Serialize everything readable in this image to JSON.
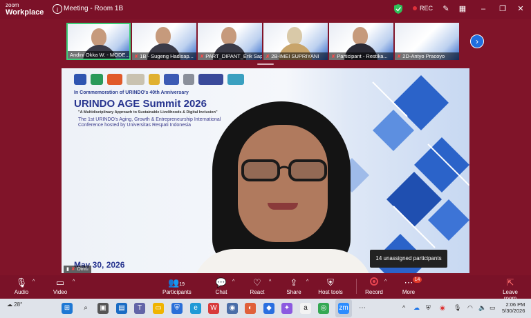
{
  "app": {
    "logo_top": "zoom",
    "logo_bottom": "Workplace",
    "meeting_title": "Meeting - Room 1B",
    "rec_label": "REC"
  },
  "titlebar_icons": [
    "shield-icon",
    "pencil-icon",
    "layout-icon",
    "minimize-icon",
    "restore-icon",
    "close-icon"
  ],
  "thumbnails": [
    {
      "name": "Andini Okka W. - MODE...",
      "muted": false,
      "active": true
    },
    {
      "name": "1B - Sugeng Hadisap...",
      "muted": true,
      "active": false
    },
    {
      "name": "PART_DIPANT_Erik Sap...",
      "muted": true,
      "active": false
    },
    {
      "name": "2B-IMEI SUPRIYANI",
      "muted": true,
      "active": false
    },
    {
      "name": "Participant - Restika...",
      "muted": true,
      "active": false
    },
    {
      "name": "2D-Antyo Pracoyo",
      "muted": true,
      "active": false
    }
  ],
  "slide": {
    "commemoration": "In Commemoration of URINDO's 40th Anniversary",
    "title": "URINDO AGE Summit 2026",
    "tagline": "\"A Multidisciplinary Approach to Sustainable Livelihoods & Digital Inclusion\"",
    "conference": "The 1st URINDO's Aging, Growth & Entrepreneurship International Conference hosted by Universitas Respati Indonesia",
    "date": "May 30, 2026"
  },
  "speaker": {
    "name": "Dinni"
  },
  "unassigned": "14 unassigned participants",
  "toolbar": {
    "audio": "Audio",
    "video": "Video",
    "participants": "Participants",
    "participants_count": "19",
    "chat": "Chat",
    "react": "React",
    "share": "Share",
    "host_tools": "Host tools",
    "record": "Record",
    "more": "More",
    "more_badge": "14",
    "leave": "Leave room"
  },
  "taskbar": {
    "weather": "28°",
    "time": "2:06 PM",
    "date": "5/30/2026"
  },
  "colors": {
    "zoom_bg": "#7a1228",
    "accent_blue": "#1f6fe0",
    "rec_red": "#e0303a",
    "active_green": "#3ed07a"
  }
}
